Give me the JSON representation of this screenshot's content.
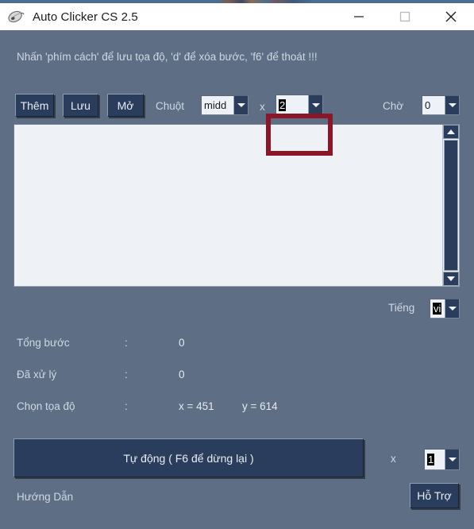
{
  "window": {
    "title": "Auto Clicker CS 2.5",
    "icon": "mouse-icon",
    "minimize_label": "minimize",
    "maximize_label": "maximize",
    "close_label": "close",
    "bg_color": "#5d6e85",
    "titlebar_bg": "#ffffff"
  },
  "hint": {
    "text": "Nhấn 'phím cách' để lưu tọa độ, 'd' để xóa bước, 'f6' để thoát !!!"
  },
  "toolbar": {
    "add_label": "Thêm",
    "save_label": "Lưu",
    "open_label": "Mở",
    "mouse_label": "Chuột",
    "mouse_value": "midd",
    "times_label": "x",
    "count_value": "2",
    "wait_label": "Chờ",
    "wait_value": "0"
  },
  "highlight": {
    "color": "#8b1627",
    "target": "count-combobox"
  },
  "language": {
    "label": "Tiếng",
    "value": "vi"
  },
  "stats": [
    {
      "name": "Tổng bước",
      "separator": ":",
      "value": "0",
      "value2": ""
    },
    {
      "name": "Đã xử lý",
      "separator": ":",
      "value": "0",
      "value2": ""
    },
    {
      "name": "Chọn tọa độ",
      "separator": ":",
      "value": "x = 451",
      "value2": "y = 614"
    }
  ],
  "bottom": {
    "auto_label": "Tự động ( F6 để dừng lại )",
    "times_label": "x",
    "multiplier_value": "1",
    "guide_label": "Hướng Dẫn",
    "support_label": "Hỗ Trợ"
  },
  "listbox": {
    "items": [],
    "scrollbar": "vertical-scrollbar"
  }
}
